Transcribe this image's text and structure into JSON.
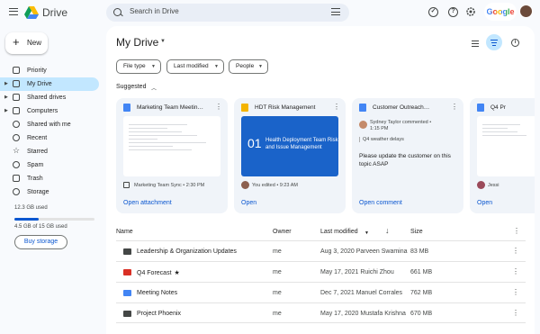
{
  "app": {
    "title": "Drive",
    "google_label": "Google"
  },
  "search": {
    "placeholder": "Search in Drive"
  },
  "sidebar": {
    "new_label": "New",
    "items": [
      {
        "label": "Priority",
        "icon": "checkbox-icon"
      },
      {
        "label": "My Drive",
        "icon": "drive-icon",
        "active": true
      },
      {
        "label": "Shared drives",
        "icon": "shared-drive-icon"
      },
      {
        "label": "Computers",
        "icon": "computer-icon"
      },
      {
        "label": "Shared with me",
        "icon": "people-icon"
      },
      {
        "label": "Recent",
        "icon": "clock-icon"
      },
      {
        "label": "Starred",
        "icon": "star-icon"
      },
      {
        "label": "Spam",
        "icon": "spam-icon"
      },
      {
        "label": "Trash",
        "icon": "trash-icon"
      },
      {
        "label": "Storage",
        "icon": "cloud-icon"
      }
    ],
    "storage_used": "12.3 GB used",
    "storage_detail": "4.5 GB of 15 GB used",
    "storage_fraction": 0.3,
    "buy_storage_label": "Buy storage"
  },
  "main": {
    "title": "My Drive",
    "filters": [
      "File type",
      "Last modified",
      "People"
    ],
    "suggested_label": "Suggested",
    "cards": [
      {
        "title": "Marketing Team Meetin…",
        "type_color": "#4285f4",
        "meta": "Marketing Team Sync • 2:30 PM",
        "action": "Open attachment"
      },
      {
        "title": "HDT Risk Management",
        "type_color": "#f4b400",
        "slide_number": "01",
        "slide_text": "Health Deployment Team Risk and Issue Management",
        "meta": "You edited • 9:23 AM",
        "action": "Open"
      },
      {
        "title": "Customer Outreach…",
        "type_color": "#4285f4",
        "comment_author": "Sydney Taylor commented •",
        "comment_time": "1:15 PM",
        "comment_quote": "Q4 weather delays",
        "comment_body": "Please update the customer on this topic ASAP",
        "action": "Open comment"
      },
      {
        "title": "Q4 Pr",
        "type_color": "#4285f4",
        "meta": "Jessi",
        "action": "Open"
      }
    ],
    "table": {
      "headers": {
        "name": "Name",
        "owner": "Owner",
        "modified": "Last modified",
        "size": "Size"
      },
      "rows": [
        {
          "name": "Leadership & Organization Updates",
          "owner": "me",
          "modified": "Aug 3, 2020 Parveen Swamina",
          "size": "83 MB",
          "icon": "folder-icon",
          "color": "#444746"
        },
        {
          "name": "Q4 Forecast",
          "starred": true,
          "owner": "me",
          "modified": "May 17, 2021 Ruichi Zhou",
          "size": "661 MB",
          "icon": "shared-folder-icon",
          "color": "#d93025"
        },
        {
          "name": "Meeting Notes",
          "owner": "me",
          "modified": "Dec 7, 2021 Manuel Corrales",
          "size": "762 MB",
          "icon": "folder-icon",
          "color": "#4285f4"
        },
        {
          "name": "Project Phoenix",
          "owner": "me",
          "modified": "May 17, 2020 Mustafa Krishna",
          "size": "670 MB",
          "icon": "shared-folder-icon",
          "color": "#444746"
        }
      ]
    }
  }
}
